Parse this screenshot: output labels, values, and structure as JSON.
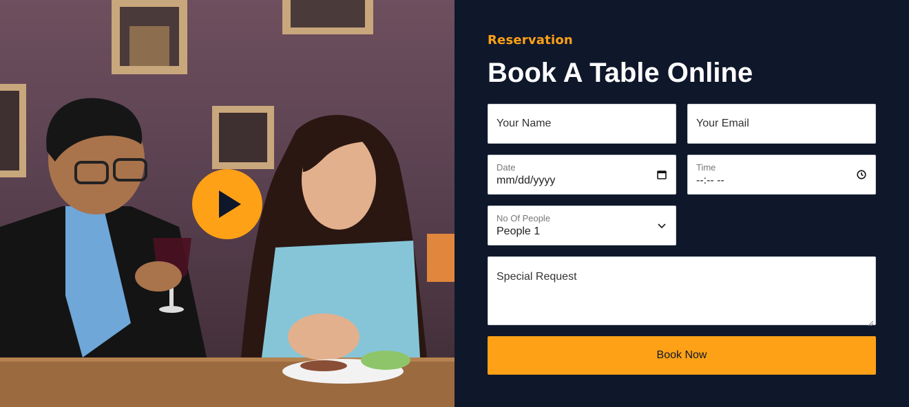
{
  "reservation": {
    "eyebrow": "Reservation",
    "title": "Book A Table Online"
  },
  "form": {
    "name": {
      "placeholder": "Your Name"
    },
    "email": {
      "placeholder": "Your Email"
    },
    "date": {
      "label": "Date",
      "value": "mm/dd/yyyy"
    },
    "time": {
      "label": "Time",
      "value": "--:-- --"
    },
    "people": {
      "label": "No Of People",
      "value": "People 1"
    },
    "request": {
      "placeholder": "Special Request"
    },
    "submit_label": "Book Now"
  },
  "icons": {
    "play": "play-icon",
    "calendar": "calendar-icon",
    "clock": "clock-icon",
    "chevron": "chevron-down-icon"
  },
  "colors": {
    "accent": "#fea116",
    "dark": "#0f172b",
    "field_bg": "#ffffff"
  }
}
